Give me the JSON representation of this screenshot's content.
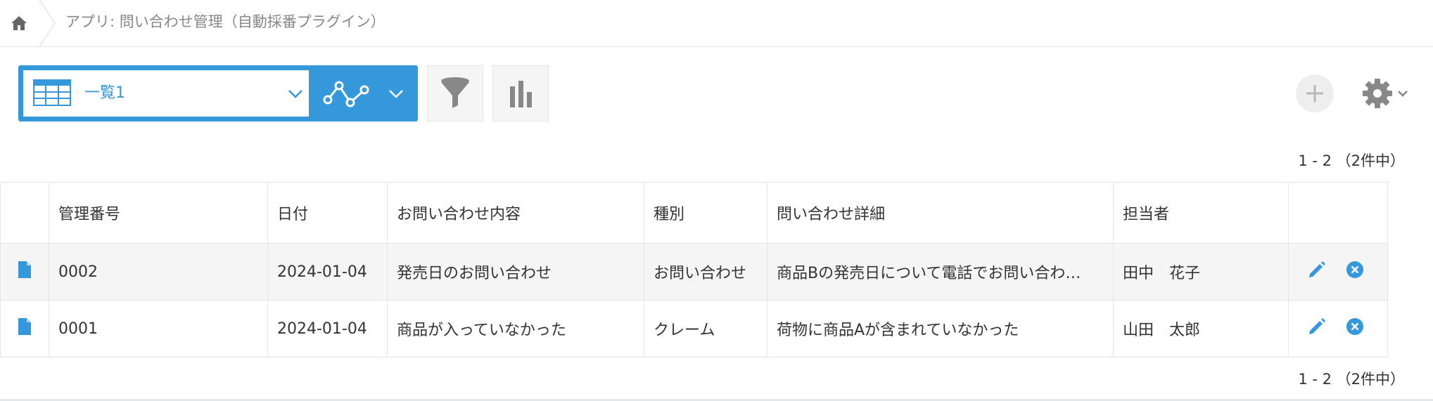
{
  "breadcrumb": {
    "home_icon": "home-icon",
    "app_title": "アプリ: 問い合わせ管理（自動採番プラグイン）"
  },
  "toolbar": {
    "view_icon": "table-view-icon",
    "view_name": "一覧1",
    "graph_icon": "line-graph-icon",
    "filter_icon": "filter-funnel-icon",
    "chart_icon": "bar-chart-icon",
    "add_icon": "plus-icon",
    "settings_icon": "gear-icon"
  },
  "pagination": {
    "top": "1 - 2 （2件中）",
    "bottom": "1 - 2 （2件中）"
  },
  "table": {
    "columns": [
      "管理番号",
      "日付",
      "お問い合わせ内容",
      "種別",
      "問い合わせ詳細",
      "担当者"
    ],
    "rows": [
      [
        "0002",
        "2024-01-04",
        "発売日のお問い合わせ",
        "お問い合わせ",
        "商品Bの発売日について電話でお問い合わ…",
        "田中　花子"
      ],
      [
        "0001",
        "2024-01-04",
        "商品が入っていなかった",
        "クレーム",
        "荷物に商品Aが含まれていなかった",
        "山田　太郎"
      ]
    ],
    "row_icons": {
      "detail": "document-icon",
      "edit": "pencil-icon",
      "delete": "close-circle-icon"
    }
  },
  "colors": {
    "accent": "#3498db",
    "border": "#e3e7e8",
    "alt_row": "#f5f5f5",
    "icon_gray": "#888888"
  }
}
